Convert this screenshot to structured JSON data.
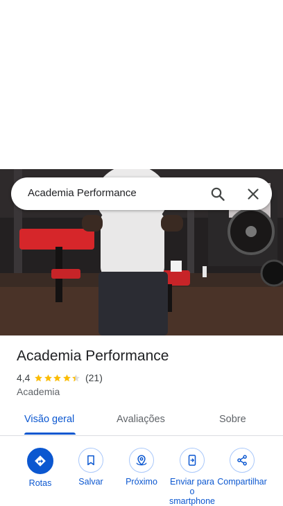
{
  "search": {
    "query": "Academia Performance"
  },
  "place": {
    "name": "Academia Performance",
    "rating": "4,4",
    "stars": 4.4,
    "review_count": "(21)",
    "category": "Academia"
  },
  "tabs": [
    {
      "label": "Visão geral",
      "active": true
    },
    {
      "label": "Avaliações",
      "active": false
    },
    {
      "label": "Sobre",
      "active": false
    }
  ],
  "actions": [
    {
      "label": "Rotas",
      "icon": "directions-icon"
    },
    {
      "label": "Salvar",
      "icon": "bookmark-icon"
    },
    {
      "label": "Próximo",
      "icon": "nearby-icon"
    },
    {
      "label": "Enviar para o smartphone",
      "icon": "send-to-phone-icon"
    },
    {
      "label": "Compartilhar",
      "icon": "share-icon"
    }
  ],
  "colors": {
    "accent": "#0b57d0",
    "star": "#fbbc04"
  }
}
